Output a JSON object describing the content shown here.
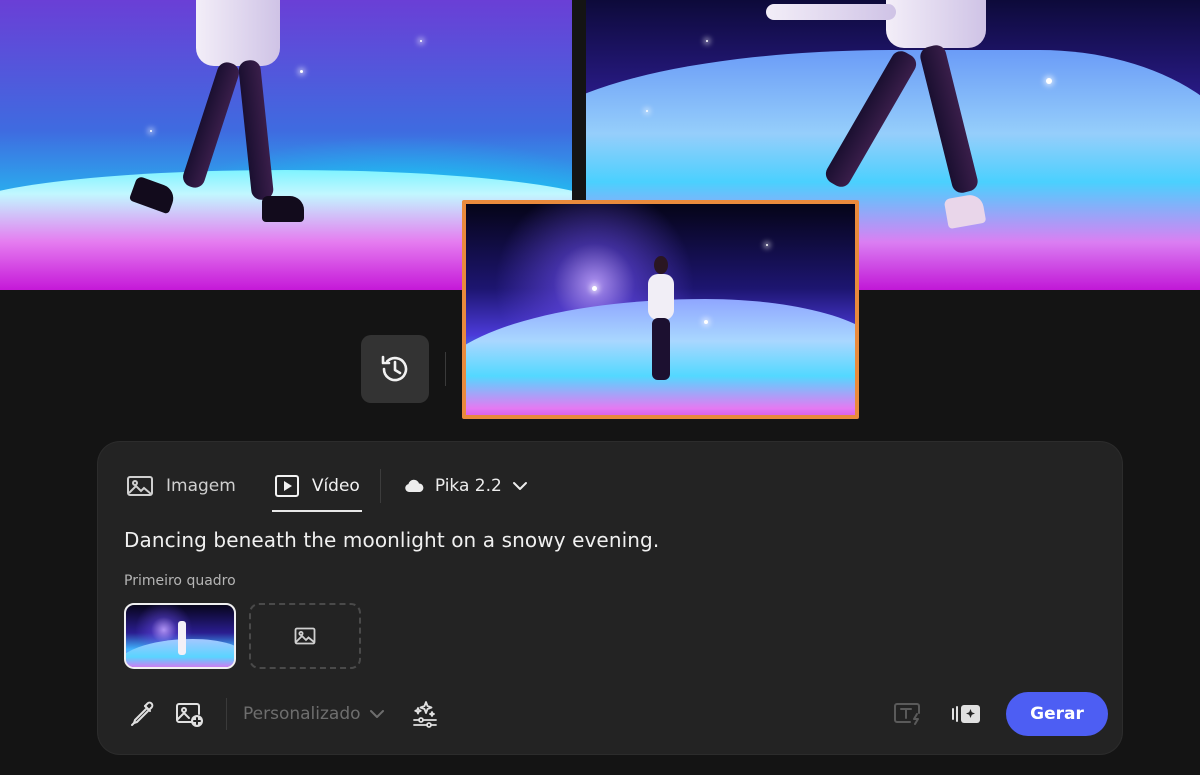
{
  "tabs": [
    {
      "label": "Imagem",
      "icon": "image-icon",
      "active": false
    },
    {
      "label": "Vídeo",
      "icon": "video-icon",
      "active": true
    }
  ],
  "model": {
    "label": "Pika 2.2",
    "icon": "cloud-icon"
  },
  "prompt": {
    "text": "Dancing beneath the moonlight on a snowy evening."
  },
  "frames": {
    "label": "Primeiro quadro"
  },
  "toolbar": {
    "style_label": "Personalizado",
    "generate_label": "Gerar"
  },
  "colors": {
    "accent": "#4d5ef3",
    "selection_border": "#e98a3c",
    "panel_bg": "#232323",
    "page_bg": "#141414"
  }
}
